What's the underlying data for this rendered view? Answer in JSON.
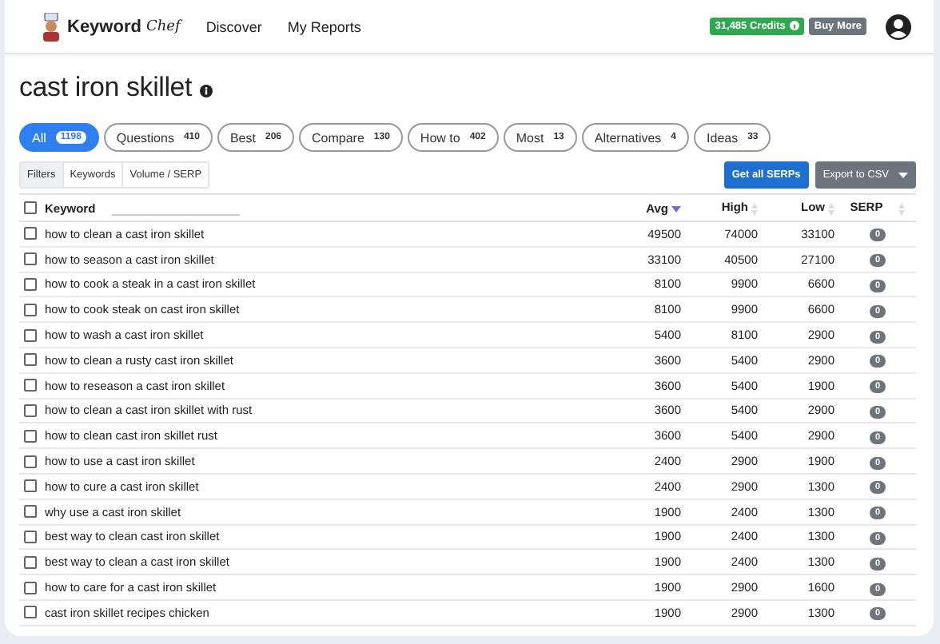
{
  "header": {
    "brand": "Keyword",
    "brand_script": "Chef",
    "nav": [
      "Discover",
      "My Reports"
    ],
    "credits": "31,485 Credits",
    "buy": "Buy More"
  },
  "title": "cast iron skillet",
  "pills": [
    {
      "label": "All",
      "count": "1198",
      "selected": true
    },
    {
      "label": "Questions",
      "count": "410",
      "selected": false
    },
    {
      "label": "Best",
      "count": "206",
      "selected": false
    },
    {
      "label": "Compare",
      "count": "130",
      "selected": false
    },
    {
      "label": "How to",
      "count": "402",
      "selected": false
    },
    {
      "label": "Most",
      "count": "13",
      "selected": false
    },
    {
      "label": "Alternatives",
      "count": "4",
      "selected": false
    },
    {
      "label": "Ideas",
      "count": "33",
      "selected": false
    }
  ],
  "view_tabs": [
    {
      "label": "Filters",
      "selected": true
    },
    {
      "label": "Keywords",
      "selected": false
    },
    {
      "label": "Volume / SERP",
      "selected": false
    }
  ],
  "actions": {
    "get_serps": "Get all SERPs",
    "export": "Export to CSV"
  },
  "table": {
    "columns": [
      "Keyword",
      "Avg",
      "High",
      "Low",
      "SERP"
    ],
    "select_all_checked": false,
    "rows": [
      {
        "keyword": "how to clean a cast iron skillet",
        "avg": "49500",
        "high": "74000",
        "low": "33100",
        "serp": "0",
        "checked": false
      },
      {
        "keyword": "how to season a cast iron skillet",
        "avg": "33100",
        "high": "40500",
        "low": "27100",
        "serp": "0",
        "checked": false
      },
      {
        "keyword": "how to cook a steak in a cast iron skillet",
        "avg": "8100",
        "high": "9900",
        "low": "6600",
        "serp": "0",
        "checked": false
      },
      {
        "keyword": "how to cook steak on cast iron skillet",
        "avg": "8100",
        "high": "9900",
        "low": "6600",
        "serp": "0",
        "checked": false
      },
      {
        "keyword": "how to wash a cast iron skillet",
        "avg": "5400",
        "high": "8100",
        "low": "2900",
        "serp": "0",
        "checked": false
      },
      {
        "keyword": "how to clean a rusty cast iron skillet",
        "avg": "3600",
        "high": "5400",
        "low": "2900",
        "serp": "0",
        "checked": false
      },
      {
        "keyword": "how to reseason a cast iron skillet",
        "avg": "3600",
        "high": "5400",
        "low": "1900",
        "serp": "0",
        "checked": false
      },
      {
        "keyword": "how to clean a cast iron skillet with rust",
        "avg": "3600",
        "high": "5400",
        "low": "2900",
        "serp": "0",
        "checked": false
      },
      {
        "keyword": "how to clean cast iron skillet rust",
        "avg": "3600",
        "high": "5400",
        "low": "2900",
        "serp": "0",
        "checked": false
      },
      {
        "keyword": "how to use a cast iron skillet",
        "avg": "2400",
        "high": "2900",
        "low": "1900",
        "serp": "0",
        "checked": false
      },
      {
        "keyword": "how to cure a cast iron skillet",
        "avg": "2400",
        "high": "2900",
        "low": "1300",
        "serp": "0",
        "checked": false
      },
      {
        "keyword": "why use a cast iron skillet",
        "avg": "1900",
        "high": "2400",
        "low": "1300",
        "serp": "0",
        "checked": false
      },
      {
        "keyword": "best way to clean cast iron skillet",
        "avg": "1900",
        "high": "2400",
        "low": "1300",
        "serp": "0",
        "checked": false
      },
      {
        "keyword": "best way to clean a cast iron skillet",
        "avg": "1900",
        "high": "2400",
        "low": "1300",
        "serp": "0",
        "checked": false
      },
      {
        "keyword": "how to care for a cast iron skillet",
        "avg": "1900",
        "high": "2900",
        "low": "1600",
        "serp": "0",
        "checked": false
      },
      {
        "keyword": "cast iron skillet recipes chicken",
        "avg": "1900",
        "high": "2900",
        "low": "1300",
        "serp": "0",
        "checked": false
      }
    ]
  }
}
